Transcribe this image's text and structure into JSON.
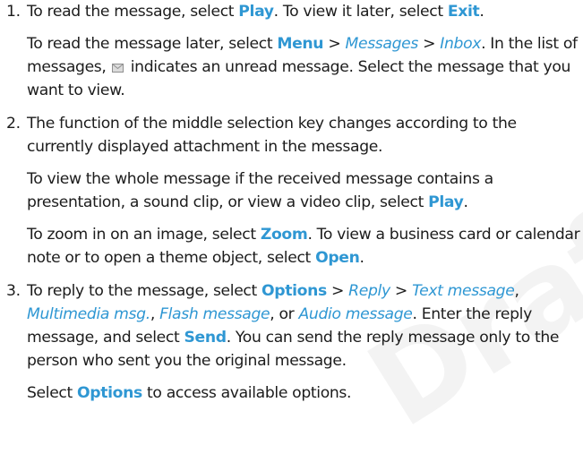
{
  "watermark": "Draft",
  "steps": [
    {
      "number": "1.",
      "p1": {
        "a": "To read the message, select ",
        "b": "Play",
        "c": ". To view it later, select ",
        "d": "Exit",
        "e": "."
      },
      "p2": {
        "a": "To read the message later, select ",
        "b": "Menu",
        "c": " > ",
        "d": "Messages",
        "e": " > ",
        "f": "Inbox",
        "g": ". In the list of messages, ",
        "h": " indicates an unread message. Select the message that you want to view."
      },
      "icon": "unread-message-envelope-icon"
    },
    {
      "number": "2.",
      "p1": "The function of the middle selection key changes according to the currently displayed attachment in the message.",
      "p2": {
        "a": "To view the whole message if the received message contains a presentation, a sound clip, or view a video clip, select ",
        "b": "Play",
        "c": "."
      },
      "p3": {
        "a": "To zoom in on an image, select ",
        "b": "Zoom",
        "c": ". To view a business card or calendar note or to open a theme object, select ",
        "d": "Open",
        "e": "."
      }
    },
    {
      "number": "3.",
      "p1": {
        "a": "To reply to the message, select ",
        "b": "Options",
        "c": " > ",
        "d": "Reply",
        "e": " > ",
        "f": "Text message",
        "g": ", ",
        "h": "Multimedia msg.",
        "i": ", ",
        "j": "Flash message",
        "k": ", or ",
        "l": "Audio message",
        "m": ". Enter the reply message, and select ",
        "n": "Send",
        "o": ". You can send the reply message only to the person who sent you the original message."
      },
      "p2": {
        "a": "Select ",
        "b": "Options",
        "c": " to access available options."
      }
    }
  ],
  "colors": {
    "keyword": "#2f97d3",
    "text": "#1c1c1c",
    "watermark": "#f3f3f3"
  }
}
